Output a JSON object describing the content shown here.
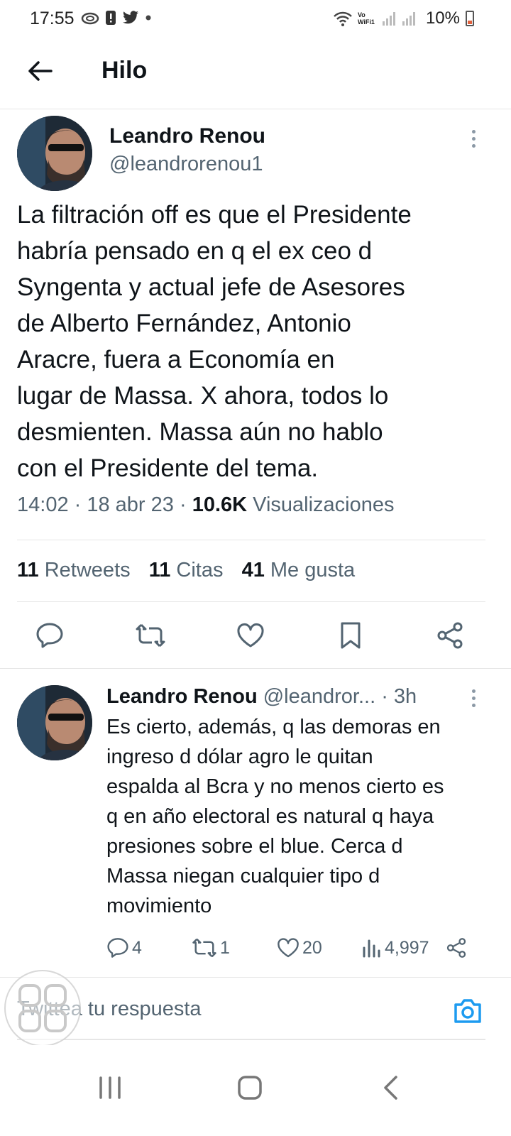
{
  "status_bar": {
    "time": "17:55",
    "battery": "10%",
    "wifi_label": "Vo WiFi1"
  },
  "header": {
    "title": "Hilo"
  },
  "main_tweet": {
    "name": "Leandro Renou",
    "handle": "@leandrorenou1",
    "text": "La filtración off es que el Presidente\nhabría pensado en q el ex ceo d\nSyngenta y actual jefe de Asesores\nde Alberto Fernández, Antonio\nAracre, fuera a Economía en\nlugar de Massa. X ahora, todos lo\ndesmienten. Massa aún no hablo\ncon el Presidente del tema.",
    "time": "14:02",
    "date": "18 abr 23",
    "views_count": "10.6K",
    "views_label": "Visualizaciones",
    "retweets_count": "11",
    "retweets_label": "Retweets",
    "quotes_count": "11",
    "quotes_label": "Citas",
    "likes_count": "41",
    "likes_label": "Me gusta"
  },
  "reply": {
    "name": "Leandro Renou",
    "handle": "@leandror...",
    "time": "· 3h",
    "text": "Es cierto, además, q las demoras en\ningreso d dólar agro le quitan\nespalda al Bcra y no menos cierto es\nq en año electoral es natural q haya\npresiones sobre el blue. Cerca d\nMassa niegan cualquier tipo d\nmovimiento",
    "replies": "4",
    "retweets": "1",
    "likes": "20",
    "views": "4,997"
  },
  "compose": {
    "placeholder": "Twittea tu respuesta"
  },
  "colors": {
    "text": "#0f1419",
    "secondary": "#536471",
    "accent": "#1d9bf0",
    "divider": "#e6e6e6"
  }
}
